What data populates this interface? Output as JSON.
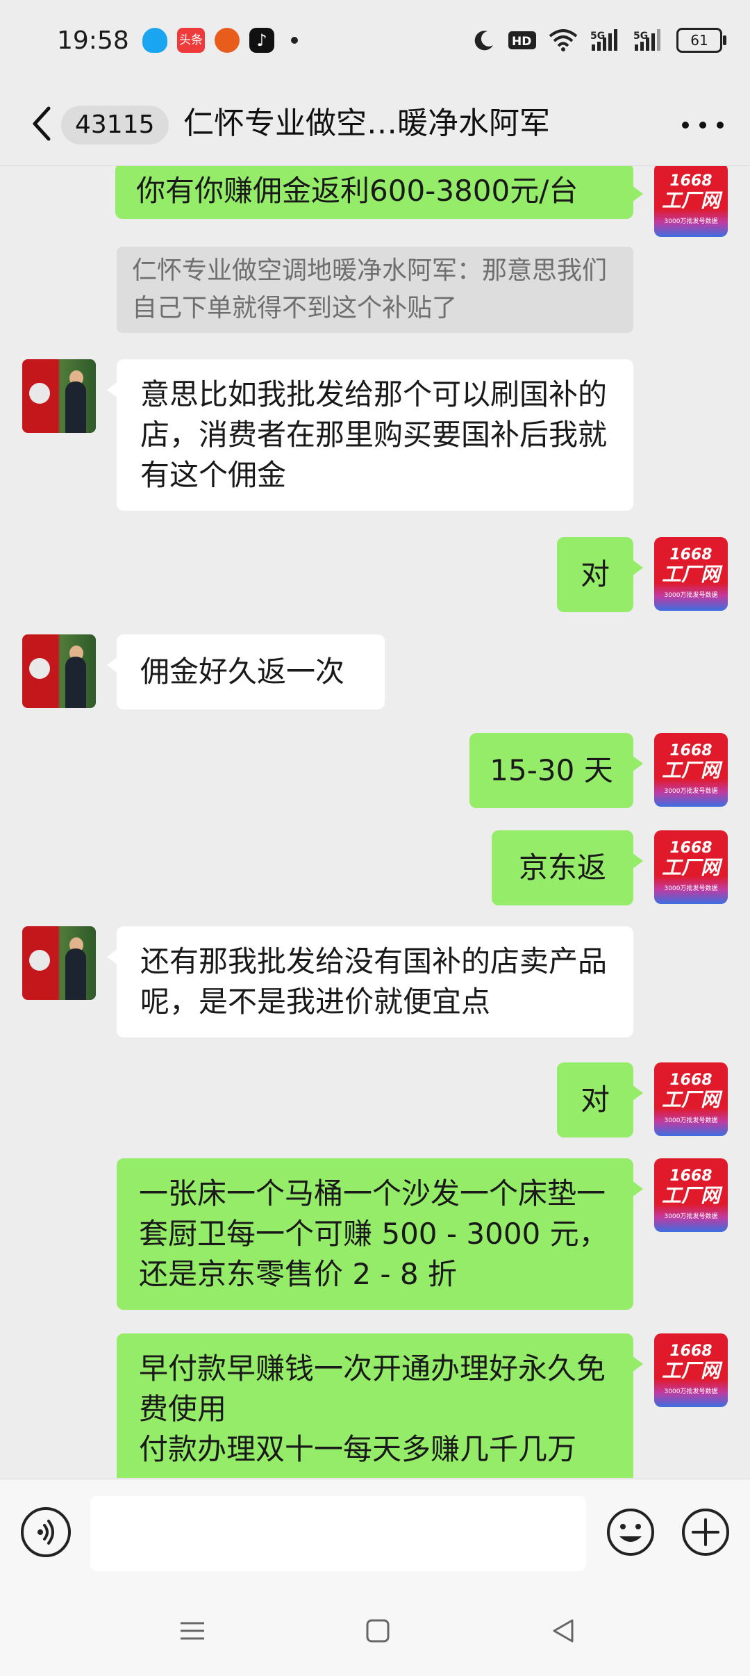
{
  "status_bar": {
    "time": "19:58",
    "app_icons": [
      "qq-icon",
      "toutiao-icon",
      "taobao-icon",
      "douyin-icon"
    ],
    "toutiao_label": "头条",
    "network_label": "5G",
    "battery": "61"
  },
  "header": {
    "unread_count": "43115",
    "title": "仁怀专业做空…暖净水阿军"
  },
  "messages": {
    "m1": "你有你赚佣金返利600-3800元/台",
    "m2": "仁怀专业做空调地暖净水阿军：那意思我们自己下单就得不到这个补贴了",
    "m3": "意思比如我批发给那个可以刷国补的店，消费者在那里购买要国补后我就有这个佣金",
    "m4": "对",
    "m5": "佣金好久返一次",
    "m6": "15-30 天",
    "m7": "京东返",
    "m8": "还有那我批发给没有国补的店卖产品呢，是不是我进价就便宜点",
    "m9": "对",
    "m10": "一张床一个马桶一个沙发一个床垫一套厨卫每一个可赚 500 - 3000 元，还是京东零售价 2 - 8 折",
    "m11": "早付款早赚钱一次开通办理好永久免费使用\n付款办理双十一每天多赚几千几万"
  },
  "avatars": {
    "me_line1": "1668",
    "me_line2": "工厂网",
    "me_line3": "3000万批发号数据"
  },
  "colors": {
    "my_bubble": "#95ec69",
    "their_bubble": "#ffffff",
    "background": "#ededed"
  }
}
